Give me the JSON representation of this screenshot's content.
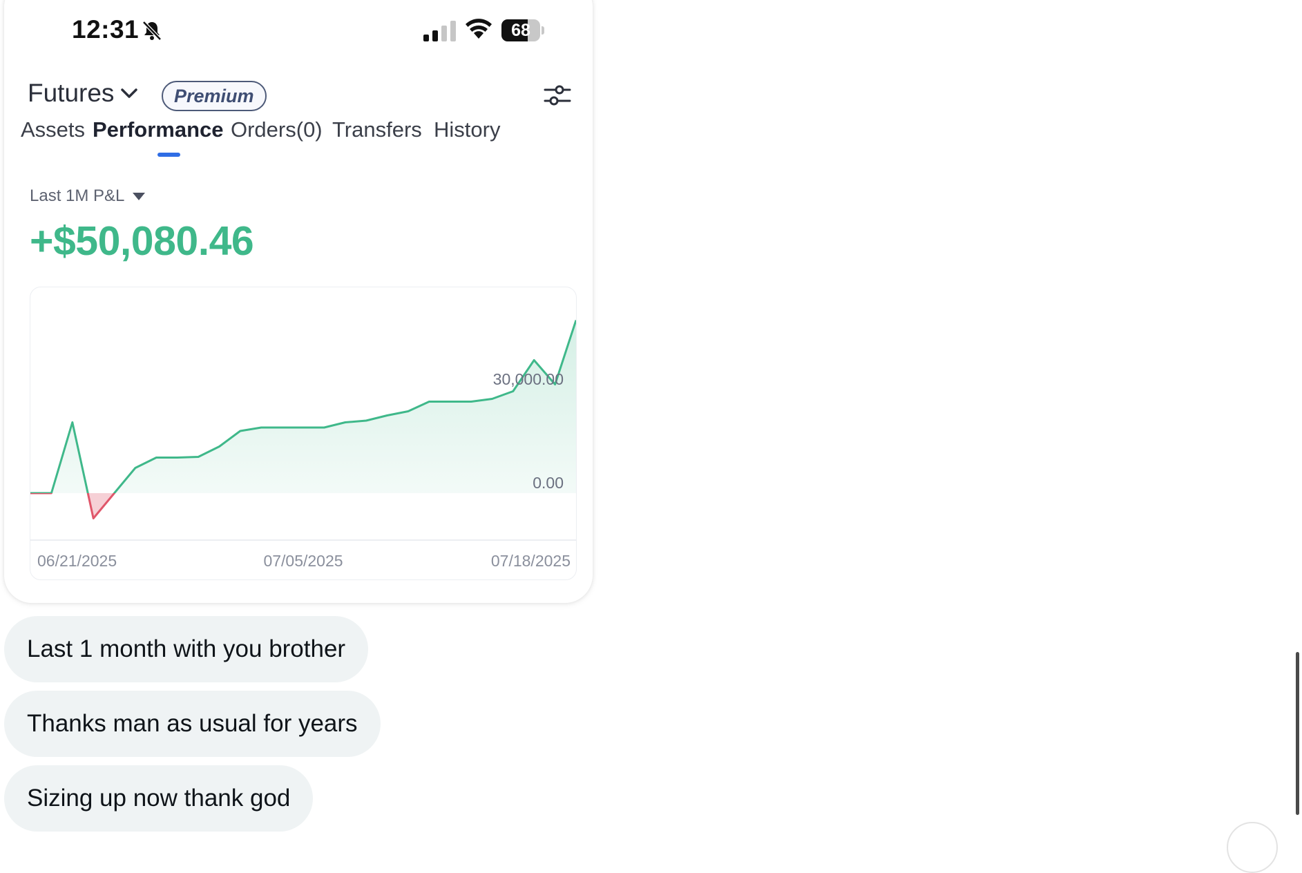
{
  "status_bar": {
    "time": "12:31",
    "battery": "68",
    "battery_level": 0.68
  },
  "header": {
    "account": "Futures",
    "badge": "Premium"
  },
  "tabs": [
    {
      "label": "Assets",
      "active": false
    },
    {
      "label": "Performance",
      "active": true
    },
    {
      "label": "Orders(0)",
      "active": false
    },
    {
      "label": "Transfers",
      "active": false
    },
    {
      "label": "History",
      "active": false
    }
  ],
  "pnl": {
    "period_label": "Last 1M P&L",
    "value": "+$50,080.46"
  },
  "colors": {
    "positive": "#3fb88a",
    "negative": "#e0566a",
    "accent": "#2f6de5"
  },
  "chart_data": {
    "type": "area",
    "y_tick_labels": [
      "30,000.00",
      "0.00"
    ],
    "x_tick_labels": [
      "06/21/2025",
      "07/05/2025",
      "07/18/2025"
    ],
    "x": [
      "06/21/2025",
      "06/22/2025",
      "06/23/2025",
      "06/24/2025",
      "06/25/2025",
      "06/26/2025",
      "06/27/2025",
      "06/28/2025",
      "06/29/2025",
      "06/30/2025",
      "07/01/2025",
      "07/02/2025",
      "07/03/2025",
      "07/04/2025",
      "07/05/2025",
      "07/06/2025",
      "07/07/2025",
      "07/08/2025",
      "07/09/2025",
      "07/10/2025",
      "07/11/2025",
      "07/12/2025",
      "07/13/2025",
      "07/14/2025",
      "07/15/2025",
      "07/16/2025",
      "07/17/2025",
      "07/18/2025"
    ],
    "values": [
      0,
      0,
      20500,
      -7300,
      0,
      7300,
      10300,
      10300,
      10500,
      13500,
      18000,
      19000,
      19000,
      19000,
      19000,
      20500,
      21000,
      22500,
      23700,
      26500,
      26500,
      26500,
      27300,
      29500,
      38500,
      31500,
      50080
    ],
    "y_unit": "$",
    "grid": false
  },
  "messages": [
    "Last 1 month with you brother",
    "Thanks man as usual for years",
    "Sizing up now thank god"
  ]
}
